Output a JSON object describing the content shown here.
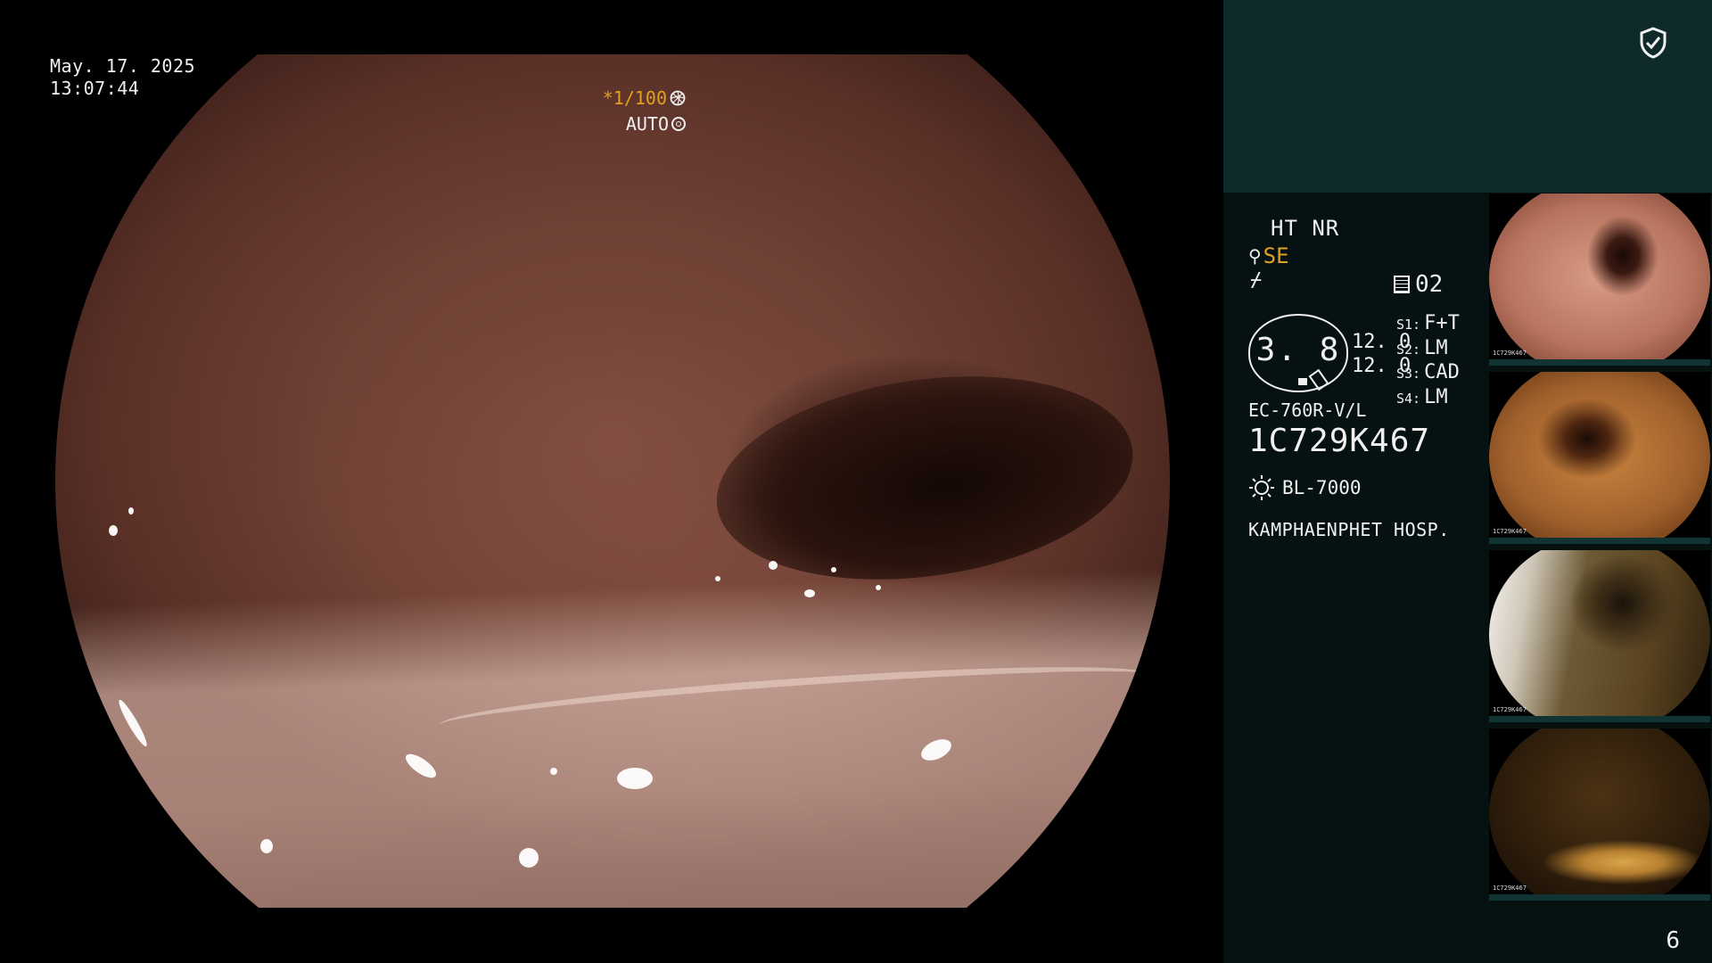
{
  "datetime": {
    "date": "May. 17. 2025",
    "time": "13:07:44"
  },
  "overlay": {
    "shutter": "*1/100",
    "iris": "AUTO"
  },
  "panel": {
    "enhance": "HT NR",
    "structure": "SE",
    "memory_slot": "02",
    "badge_value": "3. 8",
    "values": [
      "12. 0",
      "12. 0"
    ],
    "scope_modes": [
      {
        "key": "S1:",
        "value": "F+T"
      },
      {
        "key": "S2:",
        "value": "LM"
      },
      {
        "key": "S3:",
        "value": "CAD"
      },
      {
        "key": "S4:",
        "value": "LM"
      }
    ],
    "scope_model": "EC-760R-V/L",
    "serial": "1C729K467",
    "light_source": "BL-7000",
    "hospital": "KAMPHAENPHET HOSP."
  },
  "thumbnails": [
    {
      "serial": "1C729K467"
    },
    {
      "serial": "1C729K467"
    },
    {
      "serial": "1C729K467"
    },
    {
      "serial": "1C729K467"
    }
  ],
  "page_number": "6",
  "icons": [
    "shield-check-icon",
    "iris-icon",
    "auto-icon",
    "se-icon",
    "freeze-icon",
    "memory-icon",
    "sun-icon"
  ],
  "colors": {
    "accent": "#e0a020",
    "panel_top": "#0f2a2a",
    "panel_main": "#061111"
  }
}
